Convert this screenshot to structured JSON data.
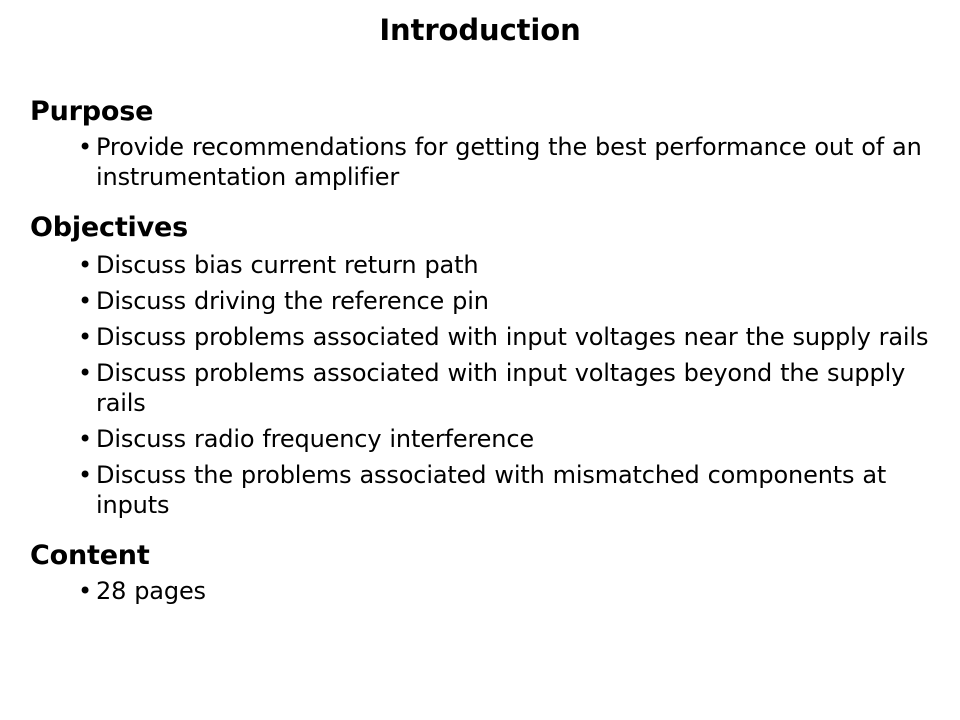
{
  "slide": {
    "title": "Introduction",
    "background_color": "#ffffff",
    "text_color": "#000000",
    "bullet_glyph": "•",
    "sections": [
      {
        "heading": "Purpose",
        "bullets": [
          "Provide recommendations for getting the best performance out of an instrumentation amplifier"
        ]
      },
      {
        "heading": "Objectives",
        "bullets": [
          "Discuss bias current return path",
          "Discuss driving the reference pin",
          "Discuss problems associated with input voltages near the supply rails",
          "Discuss problems associated with input voltages beyond the supply rails",
          "Discuss radio frequency interference",
          "Discuss the problems associated with mismatched components at inputs"
        ]
      },
      {
        "heading": "Content",
        "bullets": [
          "28 pages"
        ]
      }
    ]
  }
}
